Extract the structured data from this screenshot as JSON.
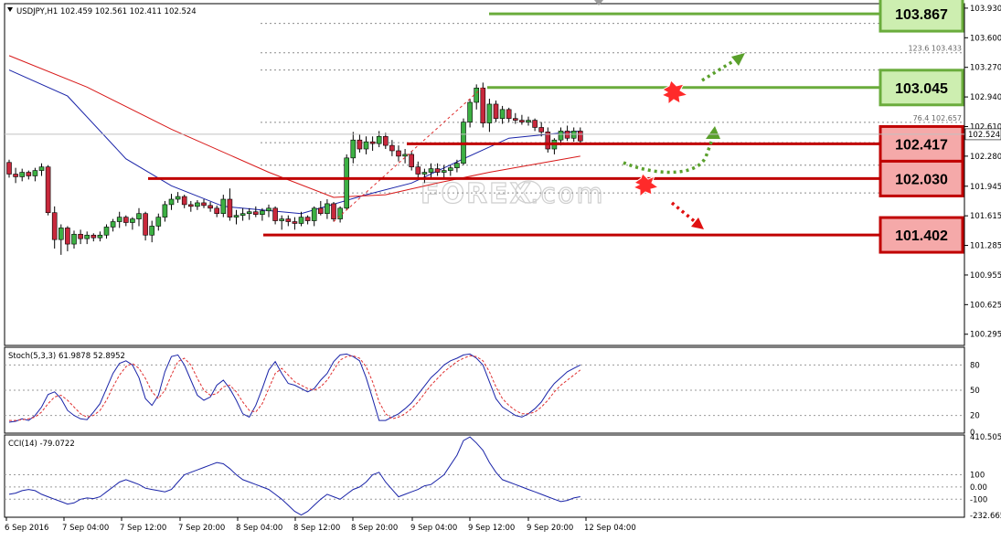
{
  "chart_data": {
    "type": "candlestick",
    "symbol_line": "USDJPY,H1  102.459 102.561 102.411 102.524",
    "price_axis": {
      "ylim": [
        100.17,
        103.98
      ],
      "ticks": [
        "103.930",
        "103.600",
        "103.270",
        "102.940",
        "102.610",
        "102.280",
        "101.945",
        "101.615",
        "101.285",
        "100.955",
        "100.625",
        "100.295"
      ],
      "current_price": "102.524"
    },
    "time_axis": {
      "ticks": [
        "6 Sep 2016",
        "7 Sep 04:00",
        "7 Sep 12:00",
        "7 Sep 20:00",
        "8 Sep 04:00",
        "8 Sep 12:00",
        "8 Sep 20:00",
        "9 Sep 04:00",
        "9 Sep 12:00",
        "9 Sep 20:00",
        "12 Sep 04:00"
      ]
    },
    "fib_levels": [
      {
        "text": "123.6  103.433",
        "value": 103.433
      },
      {
        "text": "76.4  102.657",
        "value": 102.657
      }
    ],
    "dotted_levels": [
      103.76,
      103.24,
      102.43,
      102.18,
      101.87
    ],
    "levels": [
      {
        "label": "103.867",
        "value": 103.867,
        "kind": "resistance",
        "color": "#6aac3c"
      },
      {
        "label": "103.045",
        "value": 103.045,
        "kind": "resistance",
        "color": "#6aac3c"
      },
      {
        "label": "102.417",
        "value": 102.417,
        "kind": "support",
        "color": "#c00000"
      },
      {
        "label": "102.030",
        "value": 102.03,
        "kind": "support",
        "color": "#c00000"
      },
      {
        "label": "101.402",
        "value": 101.402,
        "kind": "support",
        "color": "#c00000"
      }
    ],
    "candles": [
      [
        102.21,
        102.24,
        102.04,
        102.08
      ],
      [
        102.08,
        102.15,
        101.98,
        102.05
      ],
      [
        102.05,
        102.14,
        102.0,
        102.1
      ],
      [
        102.1,
        102.12,
        102.02,
        102.06
      ],
      [
        102.06,
        102.15,
        102.0,
        102.12
      ],
      [
        102.12,
        102.2,
        102.06,
        102.16
      ],
      [
        102.16,
        102.18,
        101.62,
        101.65
      ],
      [
        101.65,
        101.72,
        101.25,
        101.35
      ],
      [
        101.35,
        101.52,
        101.18,
        101.48
      ],
      [
        101.48,
        101.5,
        101.22,
        101.3
      ],
      [
        101.3,
        101.45,
        101.25,
        101.41
      ],
      [
        101.41,
        101.46,
        101.3,
        101.36
      ],
      [
        101.36,
        101.44,
        101.3,
        101.4
      ],
      [
        101.4,
        101.42,
        101.33,
        101.37
      ],
      [
        101.37,
        101.44,
        101.33,
        101.4
      ],
      [
        101.4,
        101.52,
        101.36,
        101.49
      ],
      [
        101.49,
        101.58,
        101.44,
        101.55
      ],
      [
        101.55,
        101.66,
        101.48,
        101.6
      ],
      [
        101.6,
        101.62,
        101.5,
        101.54
      ],
      [
        101.54,
        101.6,
        101.46,
        101.58
      ],
      [
        101.58,
        101.7,
        101.5,
        101.64
      ],
      [
        101.64,
        101.66,
        101.34,
        101.4
      ],
      [
        101.4,
        101.56,
        101.32,
        101.5
      ],
      [
        101.5,
        101.64,
        101.45,
        101.6
      ],
      [
        101.6,
        101.78,
        101.55,
        101.74
      ],
      [
        101.74,
        101.86,
        101.68,
        101.8
      ],
      [
        101.8,
        101.88,
        101.76,
        101.83
      ],
      [
        101.83,
        101.85,
        101.7,
        101.74
      ],
      [
        101.74,
        101.78,
        101.66,
        101.72
      ],
      [
        101.72,
        101.79,
        101.68,
        101.76
      ],
      [
        101.76,
        101.8,
        101.7,
        101.73
      ],
      [
        101.73,
        101.77,
        101.66,
        101.7
      ],
      [
        101.7,
        101.73,
        101.6,
        101.64
      ],
      [
        101.64,
        101.85,
        101.6,
        101.8
      ],
      [
        101.8,
        101.92,
        101.56,
        101.6
      ],
      [
        101.6,
        101.68,
        101.52,
        101.62
      ],
      [
        101.62,
        101.7,
        101.56,
        101.64
      ],
      [
        101.64,
        101.7,
        101.57,
        101.66
      ],
      [
        101.66,
        101.72,
        101.6,
        101.63
      ],
      [
        101.63,
        101.7,
        101.56,
        101.67
      ],
      [
        101.67,
        101.74,
        101.6,
        101.7
      ],
      [
        101.7,
        101.72,
        101.52,
        101.56
      ],
      [
        101.56,
        101.62,
        101.46,
        101.58
      ],
      [
        101.58,
        101.62,
        101.5,
        101.55
      ],
      [
        101.55,
        101.6,
        101.46,
        101.53
      ],
      [
        101.53,
        101.66,
        101.5,
        101.6
      ],
      [
        101.6,
        101.62,
        101.52,
        101.56
      ],
      [
        101.56,
        101.72,
        101.5,
        101.7
      ],
      [
        101.7,
        101.78,
        101.62,
        101.64
      ],
      [
        101.64,
        101.8,
        101.58,
        101.75
      ],
      [
        101.75,
        101.77,
        101.55,
        101.58
      ],
      [
        101.58,
        101.72,
        101.54,
        101.7
      ],
      [
        101.7,
        102.3,
        101.68,
        102.26
      ],
      [
        102.26,
        102.55,
        102.2,
        102.46
      ],
      [
        102.46,
        102.52,
        102.32,
        102.36
      ],
      [
        102.36,
        102.5,
        102.3,
        102.44
      ],
      [
        102.44,
        102.5,
        102.34,
        102.42
      ],
      [
        102.42,
        102.56,
        102.38,
        102.5
      ],
      [
        102.5,
        102.54,
        102.36,
        102.4
      ],
      [
        102.4,
        102.46,
        102.28,
        102.34
      ],
      [
        102.34,
        102.4,
        102.22,
        102.28
      ],
      [
        102.28,
        102.36,
        102.2,
        102.3
      ],
      [
        102.3,
        102.34,
        102.12,
        102.16
      ],
      [
        102.16,
        102.22,
        102.02,
        102.08
      ],
      [
        102.08,
        102.14,
        101.98,
        102.1
      ],
      [
        102.1,
        102.2,
        102.04,
        102.14
      ],
      [
        102.14,
        102.2,
        102.06,
        102.1
      ],
      [
        102.1,
        102.18,
        102.04,
        102.12
      ],
      [
        102.12,
        102.18,
        102.06,
        102.15
      ],
      [
        102.15,
        102.24,
        102.1,
        102.2
      ],
      [
        102.2,
        102.7,
        102.18,
        102.66
      ],
      [
        102.66,
        102.92,
        102.6,
        102.88
      ],
      [
        102.88,
        103.08,
        102.8,
        103.04
      ],
      [
        103.04,
        103.1,
        102.6,
        102.65
      ],
      [
        102.65,
        102.92,
        102.55,
        102.86
      ],
      [
        102.86,
        102.9,
        102.66,
        102.7
      ],
      [
        102.7,
        102.84,
        102.64,
        102.8
      ],
      [
        102.8,
        102.82,
        102.66,
        102.7
      ],
      [
        102.7,
        102.76,
        102.64,
        102.68
      ],
      [
        102.68,
        102.74,
        102.63,
        102.66
      ],
      [
        102.66,
        102.72,
        102.62,
        102.68
      ],
      [
        102.68,
        102.7,
        102.56,
        102.6
      ],
      [
        102.6,
        102.66,
        102.5,
        102.55
      ],
      [
        102.55,
        102.6,
        102.32,
        102.36
      ],
      [
        102.36,
        102.48,
        102.3,
        102.46
      ],
      [
        102.46,
        102.6,
        102.4,
        102.56
      ],
      [
        102.56,
        102.62,
        102.45,
        102.48
      ],
      [
        102.48,
        102.6,
        102.44,
        102.56
      ],
      [
        102.56,
        102.6,
        102.42,
        102.45
      ]
    ],
    "ma_blue": [
      [
        0,
        103.24
      ],
      [
        9,
        102.95
      ],
      [
        18,
        102.25
      ],
      [
        25,
        101.95
      ],
      [
        33,
        101.72
      ],
      [
        45,
        101.64
      ],
      [
        55,
        101.85
      ],
      [
        62,
        101.98
      ],
      [
        70,
        102.25
      ],
      [
        77,
        102.48
      ],
      [
        88,
        102.56
      ]
    ],
    "ma_red": [
      [
        0,
        103.4
      ],
      [
        12,
        103.05
      ],
      [
        25,
        102.58
      ],
      [
        40,
        102.1
      ],
      [
        50,
        101.82
      ],
      [
        58,
        101.85
      ],
      [
        66,
        101.98
      ],
      [
        74,
        102.1
      ],
      [
        88,
        102.28
      ]
    ],
    "trend_line": [
      [
        50,
        101.55
      ],
      [
        73,
        103.05
      ]
    ],
    "stoch": {
      "label": "Stoch(5,3,3) 61.9878 52.8952",
      "ticks": [
        "80",
        "50",
        "20",
        "0"
      ],
      "k": [
        12,
        13,
        16,
        14,
        20,
        30,
        45,
        48,
        40,
        26,
        20,
        16,
        15,
        24,
        34,
        52,
        70,
        82,
        85,
        80,
        65,
        40,
        32,
        44,
        72,
        90,
        92,
        80,
        62,
        44,
        38,
        42,
        56,
        62,
        52,
        38,
        22,
        18,
        32,
        52,
        74,
        84,
        70,
        58,
        56,
        52,
        48,
        52,
        62,
        70,
        84,
        92,
        93,
        90,
        85,
        65,
        40,
        14,
        14,
        18,
        22,
        28,
        35,
        45,
        55,
        65,
        72,
        80,
        85,
        88,
        92,
        93,
        88,
        80,
        60,
        40,
        30,
        25,
        20,
        18,
        22,
        28,
        36,
        48,
        58,
        65,
        72,
        76,
        80
      ],
      "d": [
        14,
        14,
        15,
        16,
        18,
        24,
        34,
        42,
        44,
        38,
        30,
        22,
        18,
        20,
        26,
        38,
        54,
        68,
        78,
        82,
        76,
        64,
        48,
        40,
        50,
        68,
        84,
        88,
        80,
        64,
        50,
        44,
        46,
        54,
        56,
        48,
        36,
        26,
        24,
        34,
        52,
        70,
        76,
        68,
        60,
        56,
        52,
        50,
        54,
        62,
        74,
        86,
        90,
        91,
        88,
        78,
        60,
        36,
        22,
        16,
        18,
        22,
        28,
        36,
        46,
        56,
        64,
        72,
        78,
        84,
        88,
        91,
        90,
        85,
        72,
        54,
        40,
        32,
        26,
        22,
        22,
        24,
        30,
        38,
        48,
        56,
        62,
        68,
        74
      ]
    },
    "cci": {
      "label": "CCI(14) -79.0722",
      "ticks": [
        "410.505",
        "100",
        "0.00",
        "-100",
        "-232.665"
      ],
      "values": [
        -60,
        -50,
        -30,
        -20,
        -30,
        -60,
        -80,
        -100,
        -120,
        -140,
        -130,
        -100,
        -90,
        -95,
        -80,
        -40,
        0,
        40,
        60,
        40,
        20,
        -10,
        -20,
        -30,
        -40,
        -20,
        40,
        100,
        120,
        140,
        160,
        180,
        200,
        190,
        150,
        100,
        60,
        40,
        20,
        0,
        -20,
        -60,
        -100,
        -150,
        -200,
        -230,
        -200,
        -150,
        -100,
        -60,
        -80,
        -100,
        -60,
        -20,
        0,
        40,
        100,
        120,
        40,
        -20,
        -80,
        -60,
        -40,
        -20,
        10,
        20,
        60,
        100,
        180,
        260,
        380,
        410,
        360,
        300,
        200,
        120,
        60,
        40,
        20,
        0,
        -20,
        -40,
        -60,
        -80,
        -100,
        -120,
        -110,
        -90,
        -79
      ]
    }
  }
}
